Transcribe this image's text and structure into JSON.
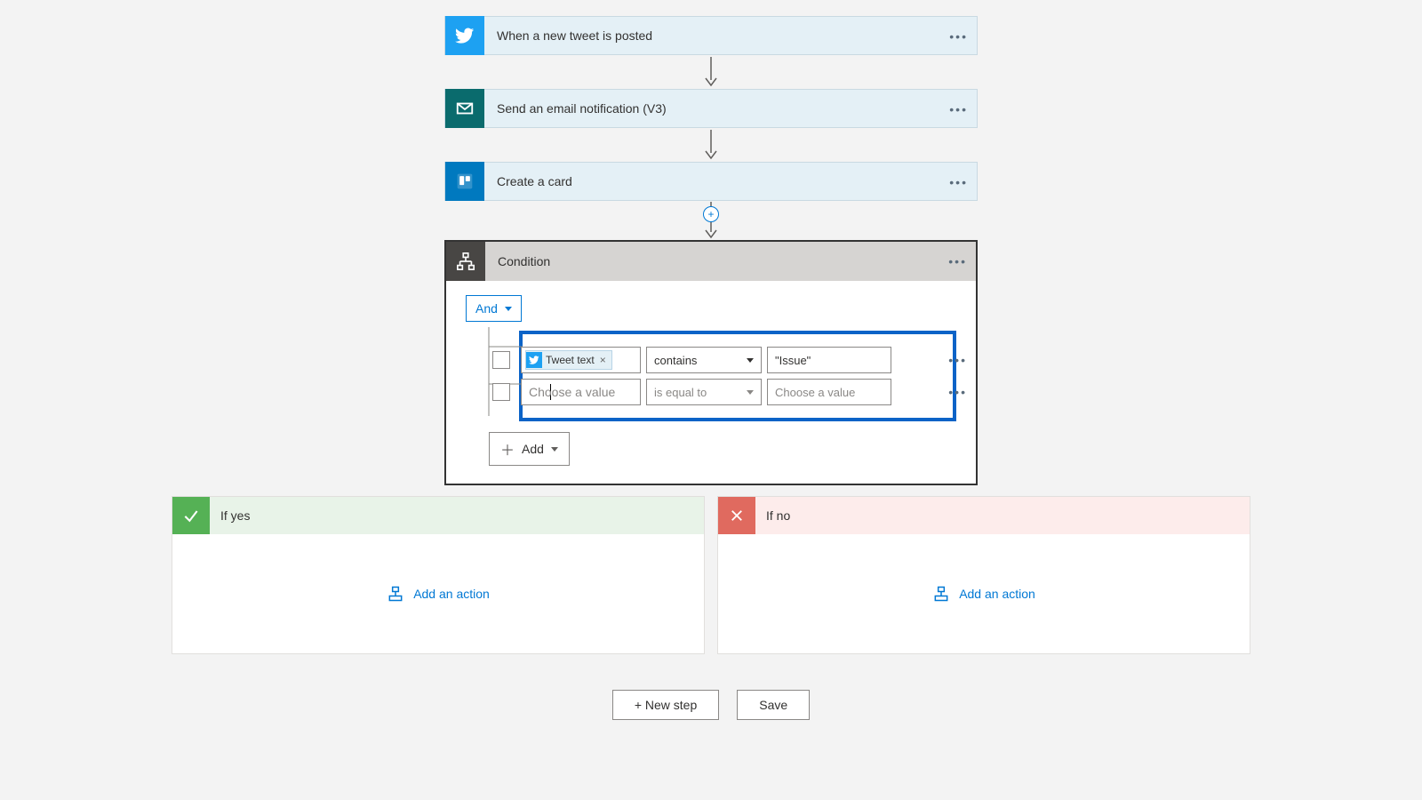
{
  "steps": [
    {
      "title": "When a new tweet is posted"
    },
    {
      "title": "Send an email notification (V3)"
    },
    {
      "title": "Create a card"
    }
  ],
  "condition": {
    "title": "Condition",
    "group_op": "And",
    "add_label": "Add",
    "rows": [
      {
        "token_label": "Tweet text",
        "operator": "contains",
        "value": "\"Issue\""
      },
      {
        "left_placeholder": "Choose a value",
        "operator_placeholder": "is equal to",
        "value_placeholder": "Choose a value"
      }
    ]
  },
  "branches": {
    "yes_label": "If yes",
    "no_label": "If no",
    "add_action_label": "Add an action"
  },
  "footer": {
    "new_step": "+ New step",
    "save": "Save"
  }
}
